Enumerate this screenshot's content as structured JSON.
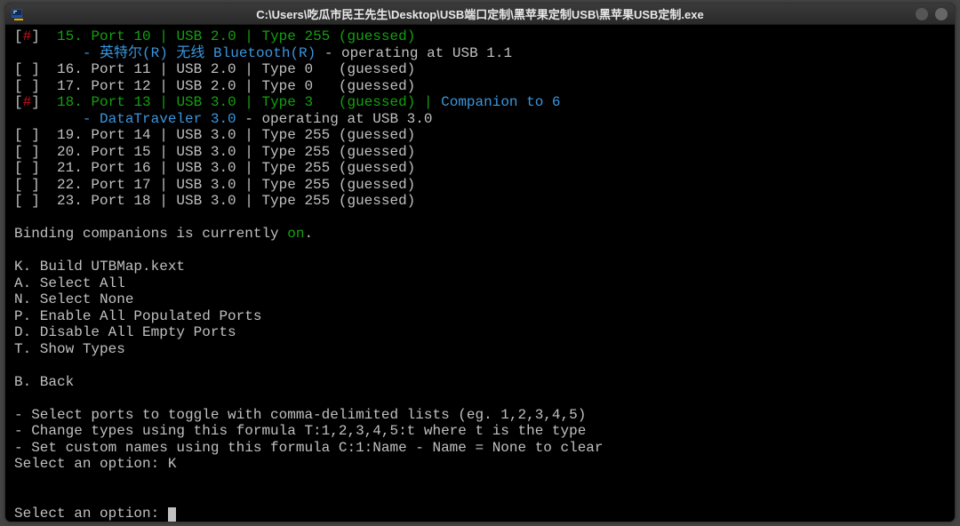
{
  "window_title": "C:\\Users\\吃瓜市民王先生\\Desktop\\USB端口定制\\黑苹果定制USB\\黑苹果USB定制.exe",
  "ports": [
    {
      "idx": 15,
      "port": 10,
      "usb": "2.0",
      "type": "255",
      "sel": true,
      "dev": "英特尔(R) 无线 Bluetooth(R)",
      "dev_at": "USB 1.1"
    },
    {
      "idx": 16,
      "port": 11,
      "usb": "2.0",
      "type": "0",
      "sel": false
    },
    {
      "idx": 17,
      "port": 12,
      "usb": "2.0",
      "type": "0",
      "sel": false
    },
    {
      "idx": 18,
      "port": 13,
      "usb": "3.0",
      "type": "3",
      "sel": true,
      "companion": "6",
      "dev": "DataTraveler 3.0",
      "dev_at": "USB 3.0"
    },
    {
      "idx": 19,
      "port": 14,
      "usb": "3.0",
      "type": "255",
      "sel": false
    },
    {
      "idx": 20,
      "port": 15,
      "usb": "3.0",
      "type": "255",
      "sel": false
    },
    {
      "idx": 21,
      "port": 16,
      "usb": "3.0",
      "type": "255",
      "sel": false
    },
    {
      "idx": 22,
      "port": 17,
      "usb": "3.0",
      "type": "255",
      "sel": false
    },
    {
      "idx": 23,
      "port": 18,
      "usb": "3.0",
      "type": "255",
      "sel": false
    }
  ],
  "binding_sentence_prefix": "Binding companions is currently ",
  "binding_state": "on",
  "menu": [
    {
      "key": "K",
      "label": "Build UTBMap.kext"
    },
    {
      "key": "A",
      "label": "Select All"
    },
    {
      "key": "N",
      "label": "Select None"
    },
    {
      "key": "P",
      "label": "Enable All Populated Ports"
    },
    {
      "key": "D",
      "label": "Disable All Empty Ports"
    },
    {
      "key": "T",
      "label": "Show Types"
    }
  ],
  "back": {
    "key": "B",
    "label": "Back"
  },
  "hints": [
    "- Select ports to toggle with comma-delimited lists (eg. 1,2,3,4,5)",
    "- Change types using this formula T:1,2,3,4,5:t where t is the type",
    "- Set custom names using this formula C:1:Name - Name = None to clear"
  ],
  "prompt1_label": "Select an option: ",
  "prompt1_input": "K",
  "prompt2_label": "Select an option: "
}
